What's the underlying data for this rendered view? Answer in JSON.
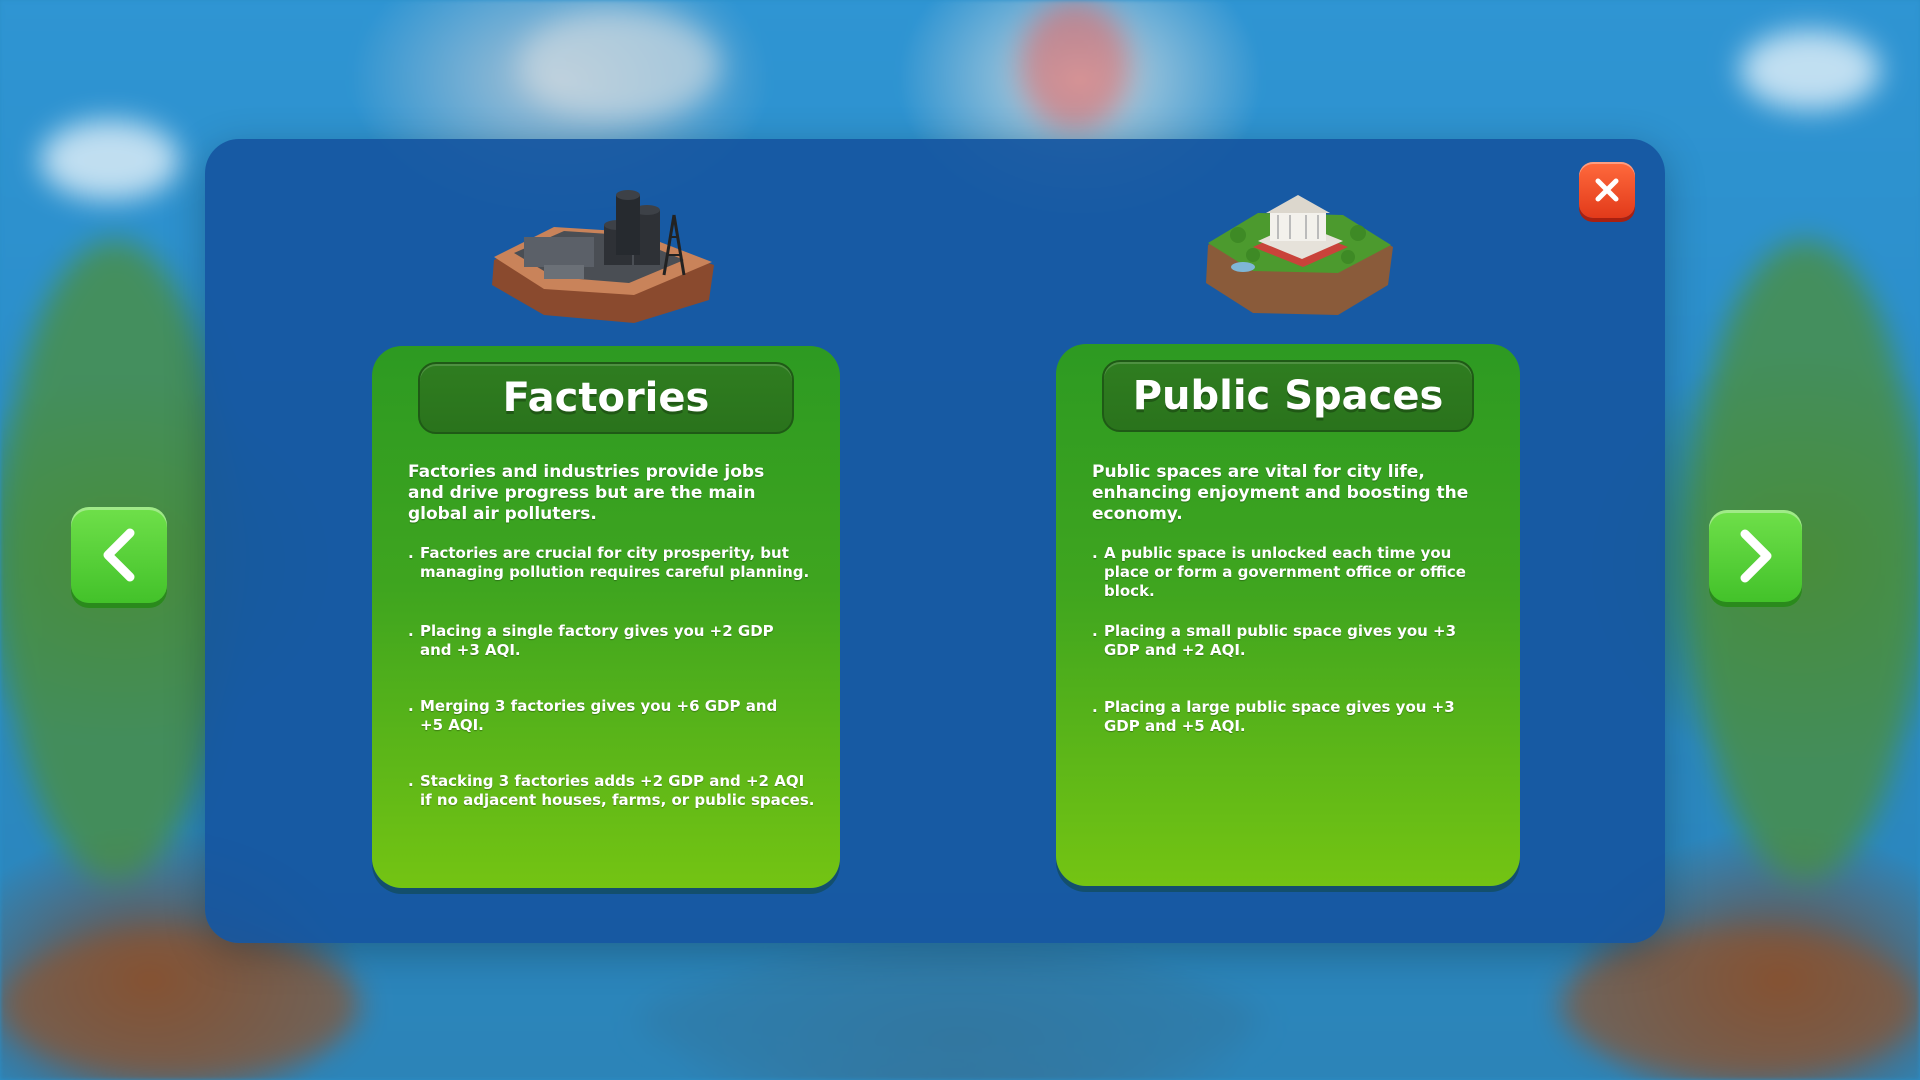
{
  "cards": {
    "factories": {
      "title": "Factories",
      "intro": "Factories and industries provide jobs and drive progress but are the main global air polluters.",
      "bullets": [
        "Factories are crucial for city prosperity, but managing pollution requires careful planning.",
        "Placing a single factory gives you +2 GDP and +3 AQI.",
        "Merging 3 factories gives you +6 GDP and +5 AQI.",
        "Stacking 3 factories adds +2 GDP and +2 AQI if no adjacent houses, farms, or public spaces."
      ],
      "icon": "factory-illustration"
    },
    "public_spaces": {
      "title": "Public Spaces",
      "intro": "Public spaces are vital for city life, enhancing enjoyment and boosting the economy.",
      "bullets": [
        "A public space is unlocked each time you place or form a government office or office block.",
        "Placing a small public space gives you +3 GDP and +2 AQI.",
        "Placing a large public space gives you +3 GDP and +5 AQI."
      ],
      "icon": "public-space-illustration"
    }
  },
  "bullet_marker": ".",
  "controls": {
    "prev_icon": "chevron-left-icon",
    "next_icon": "chevron-right-icon",
    "close_icon": "close-icon"
  },
  "colors": {
    "panel": "#1656a0",
    "card_top": "#2d9a22",
    "card_bottom": "#74c413",
    "nav_button": "#43c22a",
    "close_button": "#e23a1a"
  }
}
